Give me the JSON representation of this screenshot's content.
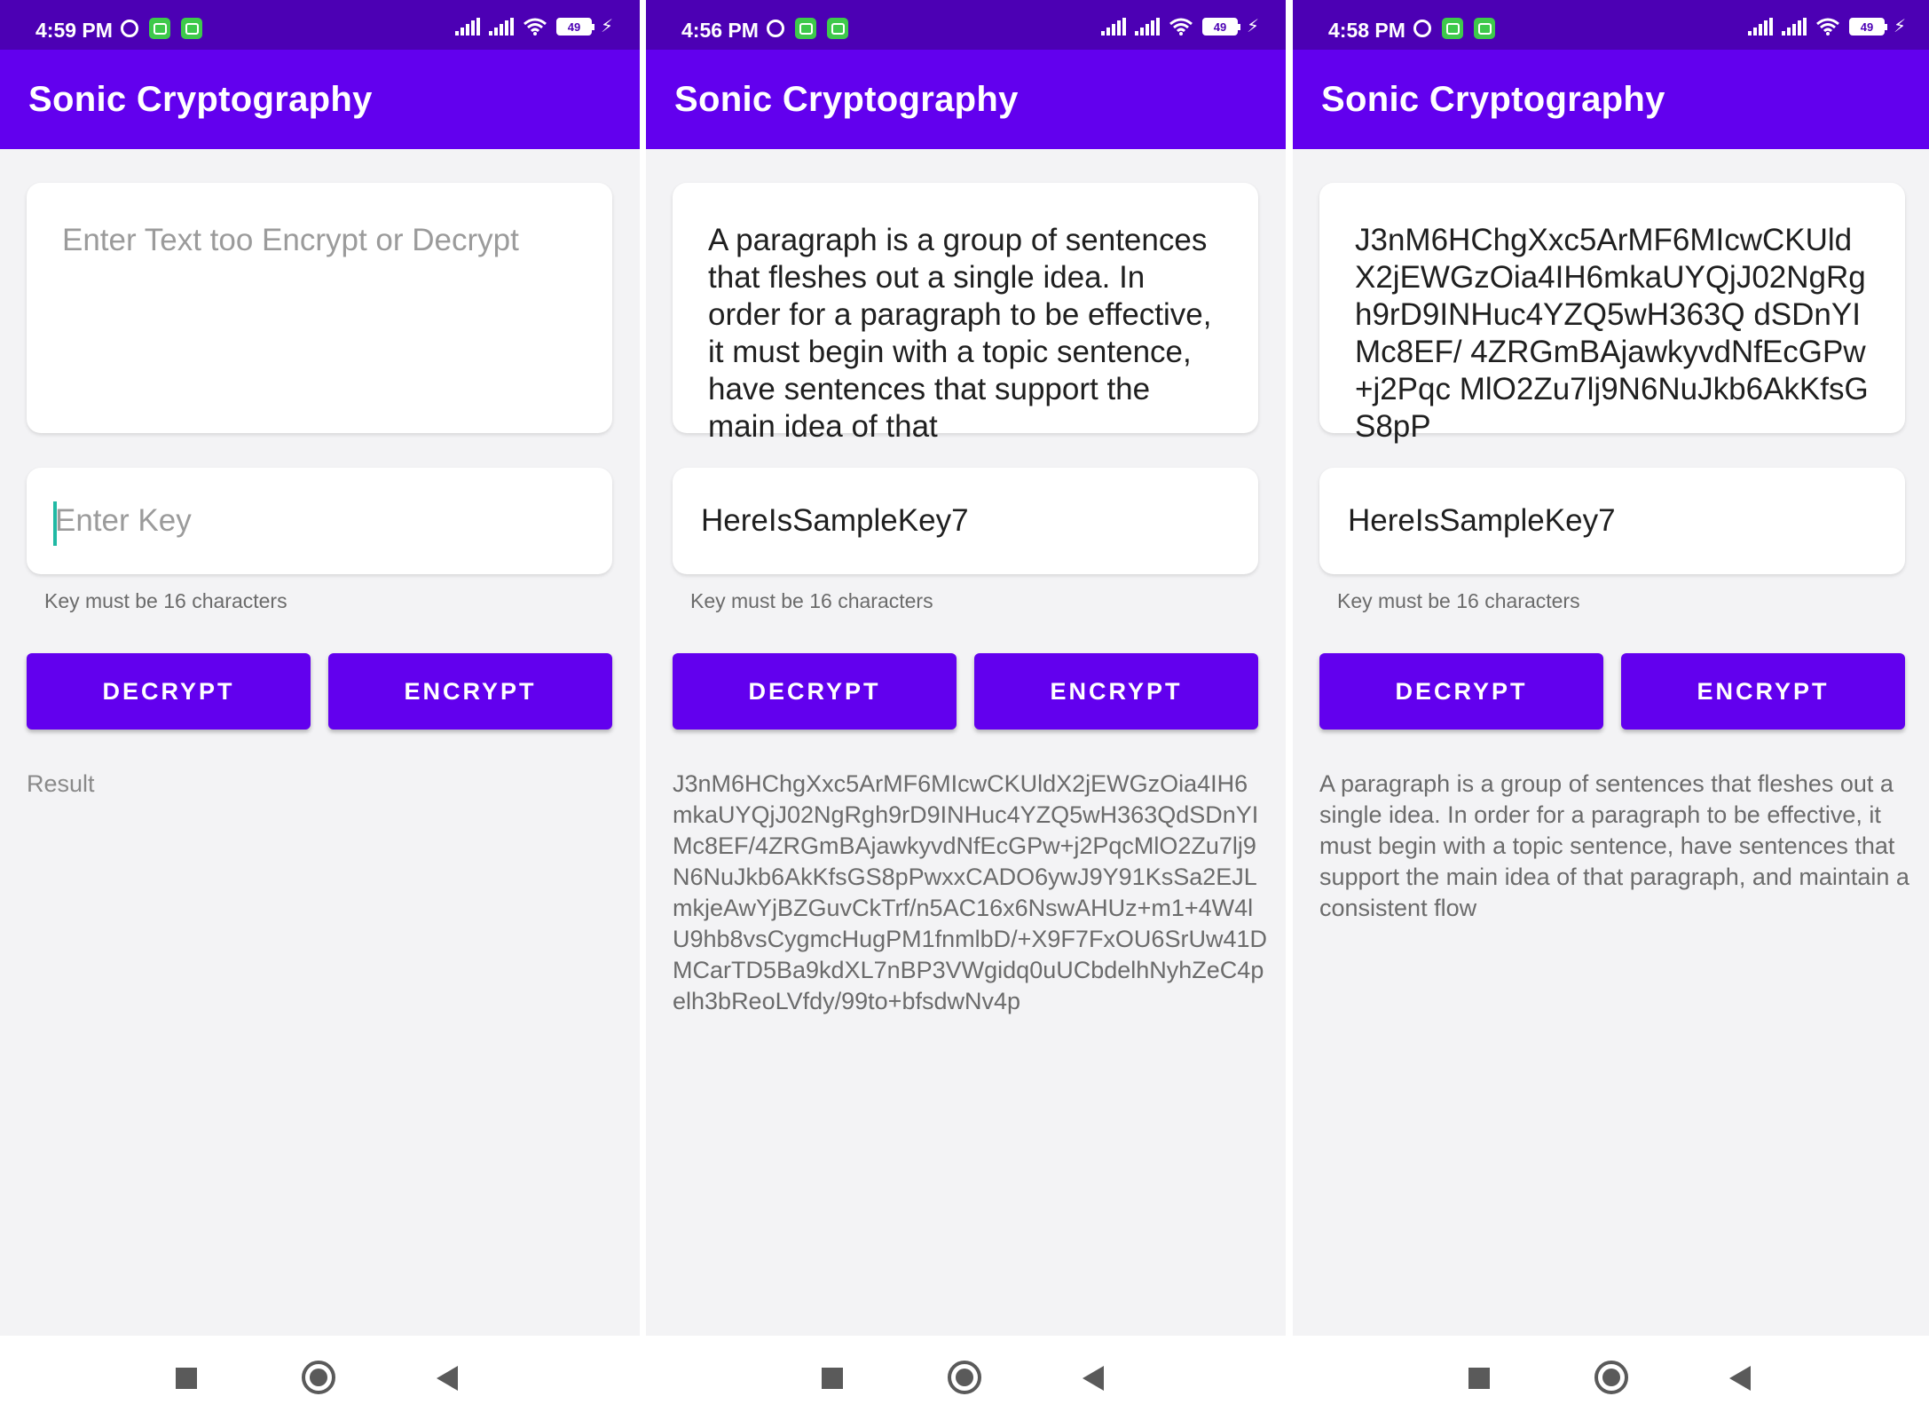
{
  "colors": {
    "status_bar": "#4c00b4",
    "app_bar": "#6200ee",
    "button": "#6200ee",
    "battery_level": 49
  },
  "screens": [
    {
      "status": {
        "time": "4:59 PM",
        "battery": "49"
      },
      "app_title": "Sonic Cryptography",
      "text_input": {
        "value": "",
        "placeholder": "Enter Text too Encrypt or Decrypt"
      },
      "key_input": {
        "value": "",
        "placeholder": "Enter Key"
      },
      "helper": "Key must be 16 characters",
      "decrypt_label": "DECRYPT",
      "encrypt_label": "ENCRYPT",
      "result": "Result"
    },
    {
      "status": {
        "time": "4:56 PM",
        "battery": "49"
      },
      "app_title": "Sonic Cryptography",
      "text_input": {
        "value": "A paragraph is a group of sentences that fleshes out a single idea. In order for a paragraph to be effective, it must begin with a topic sentence, have sentences that support the main idea of that",
        "placeholder": ""
      },
      "key_input": {
        "value": "HereIsSampleKey7",
        "placeholder": ""
      },
      "helper": "Key must be 16 characters",
      "decrypt_label": "DECRYPT",
      "encrypt_label": "ENCRYPT",
      "result": "J3nM6HChgXxc5ArMF6MIcwCKUldX2jEWGzOia4IH6mkaUYQjJ02NgRgh9rD9INHuc4YZQ5wH363QdSDnYIMc8EF/4ZRGmBAjawkyvdNfEcGPw+j2PqcMlO2Zu7lj9N6NuJkb6AkKfsGS8pPwxxCADO6ywJ9Y91KsSa2EJLmkjeAwYjBZGuvCkTrf/n5AC16x6NswAHUz+m1+4W4lU9hb8vsCygmcHugPM1fnmlbD/+X9F7FxOU6SrUw41DMCarTD5Ba9kdXL7nBP3VWgidq0uUCbdelhNyhZeC4pelh3bReoLVfdy/99to+bfsdwNv4p"
    },
    {
      "status": {
        "time": "4:58 PM",
        "battery": "49"
      },
      "app_title": "Sonic Cryptography",
      "text_input": {
        "value": "J3nM6HChgXxc5ArMF6MIcwCKUld X2jEWGzOia4IH6mkaUYQjJ02NgRg h9rD9INHuc4YZQ5wH363Q dSDnYIMc8EF/ 4ZRGmBAjawkyvdNfEcGPw+j2Pqc MlO2Zu7lj9N6NuJkb6AkKfsGS8pP",
        "placeholder": ""
      },
      "key_input": {
        "value": "HereIsSampleKey7",
        "placeholder": ""
      },
      "helper": "Key must be 16 characters",
      "decrypt_label": "DECRYPT",
      "encrypt_label": "ENCRYPT",
      "result": "A paragraph is a group of sentences that fleshes out a single idea. In order for a paragraph to be effective, it must begin with a topic sentence, have sentences that support the main idea of that paragraph, and maintain a consistent flow"
    }
  ]
}
